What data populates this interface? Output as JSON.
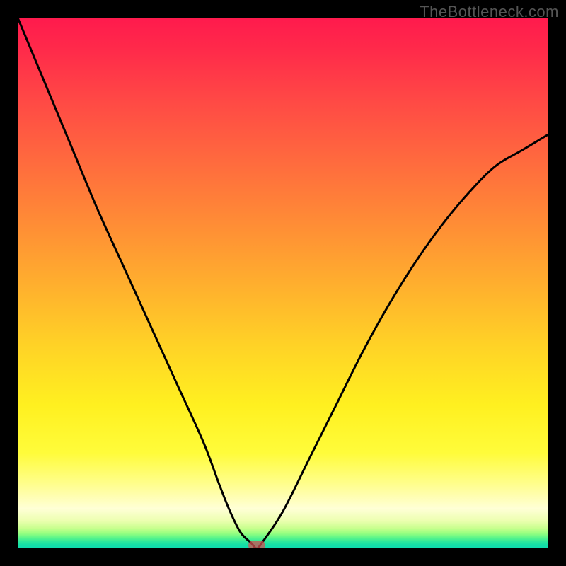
{
  "watermark": {
    "text": "TheBottleneck.com"
  },
  "chart_data": {
    "type": "line",
    "title": "",
    "xlabel": "",
    "ylabel": "",
    "xlim": [
      0,
      100
    ],
    "ylim": [
      0,
      100
    ],
    "grid": false,
    "legend": false,
    "series": [
      {
        "name": "bottleneck-curve",
        "x": [
          0,
          5,
          10,
          15,
          20,
          25,
          30,
          35,
          38,
          40,
          42,
          44,
          45,
          46,
          50,
          55,
          60,
          65,
          70,
          75,
          80,
          85,
          90,
          95,
          100
        ],
        "y": [
          100,
          88,
          76,
          64,
          53,
          42,
          31,
          20,
          12,
          7,
          3,
          1,
          0,
          1,
          7,
          17,
          27,
          37,
          46,
          54,
          61,
          67,
          72,
          75,
          78
        ]
      }
    ],
    "minimum_marker": {
      "x": 45,
      "y": 0
    },
    "background_gradient": {
      "orientation": "vertical",
      "stops": [
        {
          "pos": 0.0,
          "color": "#ff1a4d"
        },
        {
          "pos": 0.5,
          "color": "#ffae2e"
        },
        {
          "pos": 0.82,
          "color": "#fffc3a"
        },
        {
          "pos": 0.93,
          "color": "#ffffd6"
        },
        {
          "pos": 1.0,
          "color": "#0edaae"
        }
      ]
    }
  }
}
